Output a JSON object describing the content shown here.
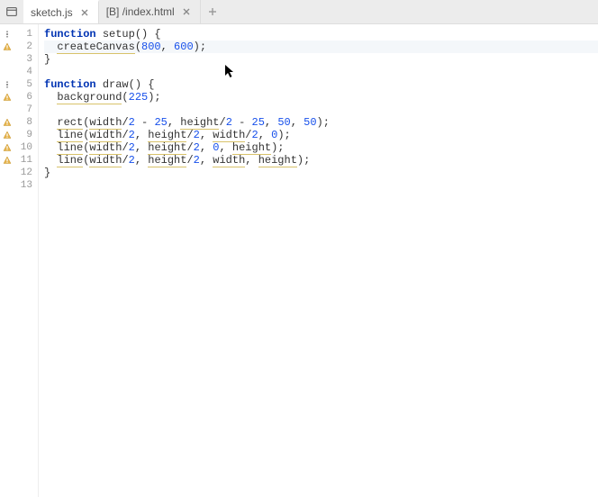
{
  "tabs": [
    {
      "label": "sketch.js",
      "active": true
    },
    {
      "label": "[B] /index.html",
      "active": false
    }
  ],
  "lines": [
    {
      "num": 1,
      "icon": "info",
      "tokens": [
        [
          "kw",
          "function"
        ],
        [
          "sp",
          " "
        ],
        [
          "fn",
          "setup"
        ],
        [
          "paren",
          "() {"
        ]
      ]
    },
    {
      "num": 2,
      "icon": "warn",
      "hl": true,
      "tokens": [
        [
          "sp",
          "  "
        ],
        [
          "call squig",
          "createCanvas"
        ],
        [
          "paren",
          "("
        ],
        [
          "num",
          "800"
        ],
        [
          "paren",
          ", "
        ],
        [
          "num",
          "600"
        ],
        [
          "paren",
          ");"
        ]
      ]
    },
    {
      "num": 3,
      "icon": "",
      "tokens": [
        [
          "paren",
          "}"
        ]
      ]
    },
    {
      "num": 4,
      "icon": "",
      "tokens": []
    },
    {
      "num": 5,
      "icon": "info",
      "tokens": [
        [
          "kw",
          "function"
        ],
        [
          "sp",
          " "
        ],
        [
          "fn",
          "draw"
        ],
        [
          "paren",
          "() {"
        ]
      ]
    },
    {
      "num": 6,
      "icon": "warn",
      "tokens": [
        [
          "sp",
          "  "
        ],
        [
          "call squig",
          "background"
        ],
        [
          "paren",
          "("
        ],
        [
          "num",
          "225"
        ],
        [
          "paren",
          ");"
        ]
      ]
    },
    {
      "num": 7,
      "icon": "",
      "tokens": []
    },
    {
      "num": 8,
      "icon": "warn",
      "tokens": [
        [
          "sp",
          "  "
        ],
        [
          "call squig",
          "rect"
        ],
        [
          "paren",
          "("
        ],
        [
          "call squig",
          "width"
        ],
        [
          "paren",
          "/"
        ],
        [
          "num",
          "2"
        ],
        [
          "paren",
          " - "
        ],
        [
          "num",
          "25"
        ],
        [
          "paren",
          ", "
        ],
        [
          "call squig",
          "height"
        ],
        [
          "paren",
          "/"
        ],
        [
          "num",
          "2"
        ],
        [
          "paren",
          " - "
        ],
        [
          "num",
          "25"
        ],
        [
          "paren",
          ", "
        ],
        [
          "num",
          "50"
        ],
        [
          "paren",
          ", "
        ],
        [
          "num",
          "50"
        ],
        [
          "paren",
          ");"
        ]
      ]
    },
    {
      "num": 9,
      "icon": "warn",
      "tokens": [
        [
          "sp",
          "  "
        ],
        [
          "call squig",
          "line"
        ],
        [
          "paren",
          "("
        ],
        [
          "call squig",
          "width"
        ],
        [
          "paren",
          "/"
        ],
        [
          "num",
          "2"
        ],
        [
          "paren",
          ", "
        ],
        [
          "call squig",
          "height"
        ],
        [
          "paren",
          "/"
        ],
        [
          "num",
          "2"
        ],
        [
          "paren",
          ", "
        ],
        [
          "call squig",
          "width"
        ],
        [
          "paren",
          "/"
        ],
        [
          "num",
          "2"
        ],
        [
          "paren",
          ", "
        ],
        [
          "num",
          "0"
        ],
        [
          "paren",
          ");"
        ]
      ]
    },
    {
      "num": 10,
      "icon": "warn",
      "tokens": [
        [
          "sp",
          "  "
        ],
        [
          "call squig",
          "line"
        ],
        [
          "paren",
          "("
        ],
        [
          "call squig",
          "width"
        ],
        [
          "paren",
          "/"
        ],
        [
          "num",
          "2"
        ],
        [
          "paren",
          ", "
        ],
        [
          "call squig",
          "height"
        ],
        [
          "paren",
          "/"
        ],
        [
          "num",
          "2"
        ],
        [
          "paren",
          ", "
        ],
        [
          "num",
          "0"
        ],
        [
          "paren",
          ", "
        ],
        [
          "call squig",
          "height"
        ],
        [
          "paren",
          ");"
        ]
      ]
    },
    {
      "num": 11,
      "icon": "warn",
      "tokens": [
        [
          "sp",
          "  "
        ],
        [
          "call squig",
          "line"
        ],
        [
          "paren",
          "("
        ],
        [
          "call squig",
          "width"
        ],
        [
          "paren",
          "/"
        ],
        [
          "num",
          "2"
        ],
        [
          "paren",
          ", "
        ],
        [
          "call squig",
          "height"
        ],
        [
          "paren",
          "/"
        ],
        [
          "num",
          "2"
        ],
        [
          "paren",
          ", "
        ],
        [
          "call squig",
          "width"
        ],
        [
          "paren",
          ", "
        ],
        [
          "call squig",
          "height"
        ],
        [
          "paren",
          ");"
        ]
      ]
    },
    {
      "num": 12,
      "icon": "",
      "tokens": [
        [
          "paren",
          "}"
        ]
      ]
    },
    {
      "num": 13,
      "icon": "",
      "tokens": []
    }
  ]
}
